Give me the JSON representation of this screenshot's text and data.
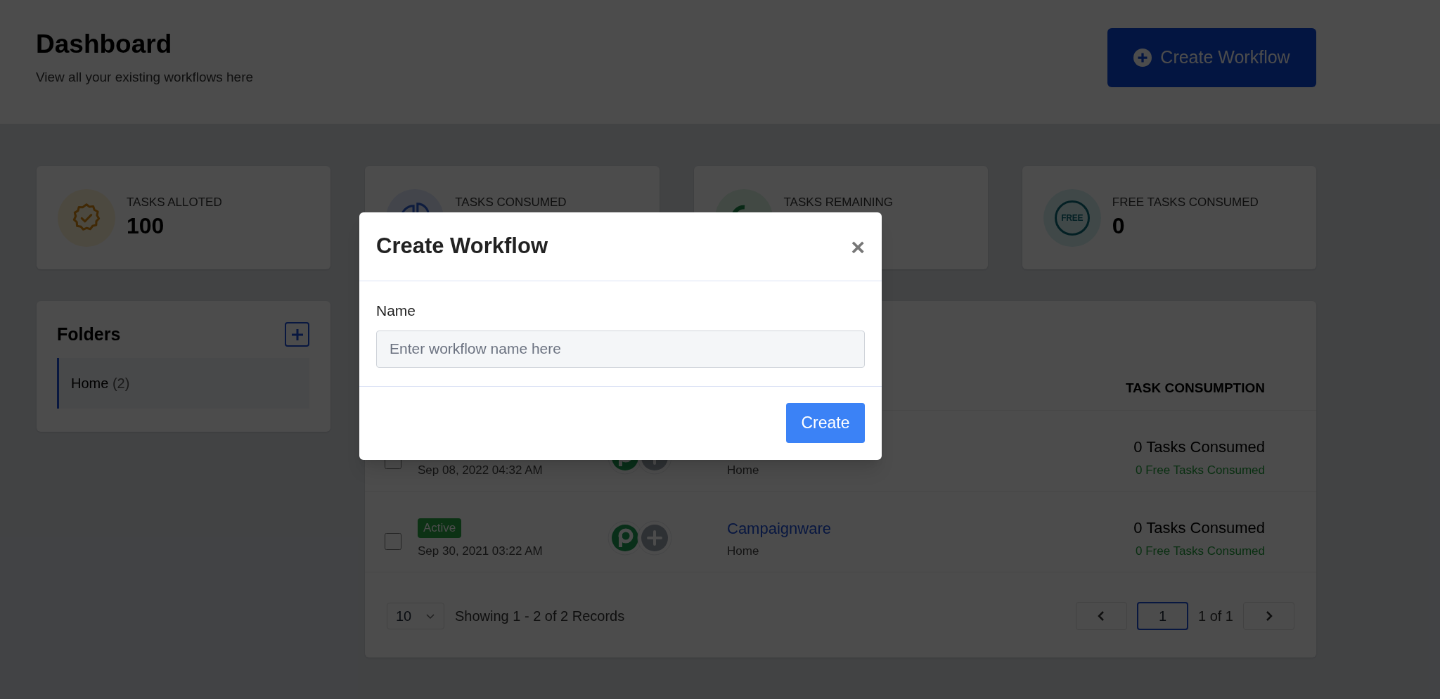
{
  "header": {
    "title": "Dashboard",
    "subtitle": "View all your existing workflows here",
    "create_button": "Create Workflow"
  },
  "stats": [
    {
      "kind": "alloted",
      "label": "TASKS ALLOTED",
      "value": "100"
    },
    {
      "kind": "consumed",
      "label": "TASKS CONSUMED"
    },
    {
      "kind": "remaining",
      "label": "TASKS REMAINING"
    },
    {
      "kind": "free",
      "label": "FREE TASKS CONSUMED",
      "value": "0",
      "icon_text": "FREE"
    }
  ],
  "folders": {
    "title": "Folders",
    "items": [
      {
        "name": "Home",
        "count": "(2)",
        "selected": true
      }
    ]
  },
  "table": {
    "columns": [
      "TASK CONSUMPTION"
    ],
    "rows": [
      {
        "checked": false,
        "date": "Sep 08, 2022 04:32 AM",
        "folder": "Home",
        "tasks": "0 Tasks Consumed",
        "free_tasks": "0 Free Tasks Consumed"
      },
      {
        "checked": false,
        "status": "Active",
        "date": "Sep 30, 2021 03:22 AM",
        "name": "Campaignware",
        "folder": "Home",
        "tasks": "0 Tasks Consumed",
        "free_tasks": "0 Free Tasks Consumed"
      }
    ],
    "footer": {
      "per_page": "10",
      "showing": "Showing 1 - 2 of 2 Records",
      "page": "1",
      "page_of": "1 of 1"
    }
  },
  "modal": {
    "title": "Create Workflow",
    "close": "×",
    "field_label": "Name",
    "placeholder": "Enter workflow name here",
    "submit": "Create"
  }
}
